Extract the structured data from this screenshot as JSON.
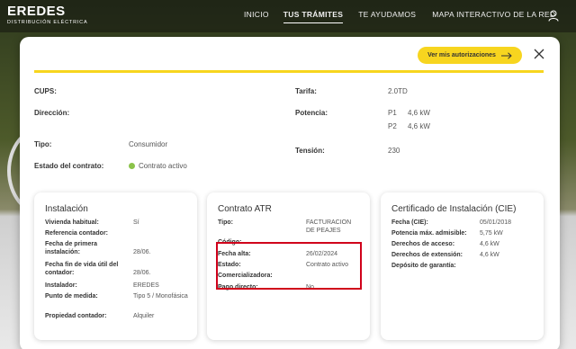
{
  "logo": {
    "name": "EREDES",
    "sub": "DISTRIBUCIÓN ELÉCTRICA"
  },
  "nav": [
    "INICIO",
    "TUS TRÁMITES",
    "TE AYUDAMOS",
    "MAPA INTERACTIVO DE LA RED"
  ],
  "modal": {
    "auth_button": "Ver mis autorizaciones",
    "left_fields": {
      "cups": "CUPS:",
      "direccion": "Dirección:",
      "tipo_label": "Tipo:",
      "tipo_value": "Consumidor",
      "estado_label": "Estado del contrato:",
      "estado_value": "Contrato activo"
    },
    "right_fields": {
      "tarifa_label": "Tarifa:",
      "tarifa_value": "2.0TD",
      "potencia_label": "Potencia:",
      "p1": "P1",
      "p1_value": "4,6 kW",
      "p2": "P2",
      "p2_value": "4,6 kW",
      "tension_label": "Tensión:",
      "tension_value": "230"
    }
  },
  "cards": {
    "instalacion": {
      "title": "Instalación",
      "rows": [
        {
          "k": "Vivienda habitual:",
          "v": "Sí"
        },
        {
          "k": "Referencia contador:",
          "v": ""
        },
        {
          "k": "Fecha de primera instalación:",
          "v": "28/06."
        },
        {
          "k": "Fecha fin de vida útil del contador:",
          "v": "28/06."
        },
        {
          "k": "Instalador:",
          "v": "EREDES"
        },
        {
          "k": "Punto de medida:",
          "v": "Tipo 5 / Monofásica"
        },
        {
          "k": "Propiedad contador:",
          "v": "Alquiler"
        }
      ]
    },
    "contrato": {
      "title": "Contrato ATR",
      "rows": [
        {
          "k": "Tipo:",
          "v": "FACTURACION DE PEAJES"
        },
        {
          "k": "Código:",
          "v": ""
        },
        {
          "k": "Fecha alta:",
          "v": "26/02/2024"
        },
        {
          "k": "Estado:",
          "v": "Contrato activo"
        },
        {
          "k": "Comercializadora:",
          "v": ""
        },
        {
          "k": "Pago directo:",
          "v": "No"
        }
      ]
    },
    "cie": {
      "title": "Certificado de Instalación (CIE)",
      "rows": [
        {
          "k": "Fecha (CIE):",
          "v": "05/01/2018"
        },
        {
          "k": "Potencia máx. admisible:",
          "v": "5,75 kW"
        },
        {
          "k": "Derechos de acceso:",
          "v": "4,6 kW"
        },
        {
          "k": "Derechos de extensión:",
          "v": "4,6 kW"
        },
        {
          "k": "Depósito de garantía:",
          "v": ""
        }
      ]
    }
  }
}
